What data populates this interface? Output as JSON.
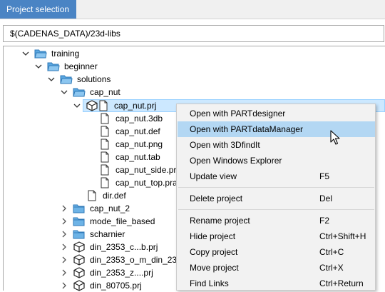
{
  "tab": {
    "label": "Project selection"
  },
  "path": {
    "value": "$(CADENAS_DATA)/23d-libs"
  },
  "tree": {
    "training": "training",
    "beginner": "beginner",
    "solutions": "solutions",
    "cap_nut": "cap_nut",
    "cap_nut_prj": "cap_nut.prj",
    "files": [
      "cap_nut.3db",
      "cap_nut.def",
      "cap_nut.png",
      "cap_nut.tab",
      "cap_nut_side.pra",
      "cap_nut_top.pra"
    ],
    "dir_def": "dir.def",
    "cap_nut_2": "cap_nut_2",
    "mode_file_based": "mode_file_based",
    "scharnier": "scharnier",
    "din1": "din_2353_c...b.prj",
    "din2": "din_2353_o_m_din_2353",
    "din3": "din_2353_z....prj",
    "din4": "din_80705.prj"
  },
  "menu": {
    "items": [
      {
        "label": "Open with PARTdesigner",
        "shortcut": ""
      },
      {
        "label": "Open with PARTdataManager",
        "shortcut": ""
      },
      {
        "label": "Open with 3DfindIt",
        "shortcut": ""
      },
      {
        "label": "Open Windows Explorer",
        "shortcut": ""
      },
      {
        "label": "Update view",
        "shortcut": "F5"
      },
      {
        "label": "Delete project",
        "shortcut": "Del"
      },
      {
        "label": "Rename project",
        "shortcut": "F2"
      },
      {
        "label": "Hide project",
        "shortcut": "Ctrl+Shift+H"
      },
      {
        "label": "Copy project",
        "shortcut": "Ctrl+C"
      },
      {
        "label": "Move project",
        "shortcut": "Ctrl+X"
      },
      {
        "label": "Find Links",
        "shortcut": "Ctrl+Return"
      }
    ]
  },
  "colors": {
    "tab": "#4a84c4",
    "selection": "#cce8ff",
    "menu_highlight": "#b3d7f3",
    "folder": "#5aa6e0"
  },
  "icons": [
    "expand-arrow-icon",
    "collapse-arrow-icon",
    "folder-icon",
    "cube-project-icon",
    "file-icon",
    "mouse-cursor-icon"
  ]
}
